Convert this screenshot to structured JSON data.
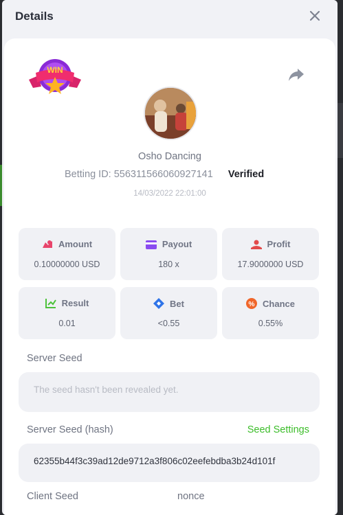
{
  "header": {
    "title": "Details"
  },
  "game": {
    "name": "Osho Dancing",
    "betting_id_label": "Betting ID: 556311566060927141",
    "verified": "Verified",
    "timestamp": "14/03/2022 22:01:00",
    "badge_text": "WIN"
  },
  "stats": [
    {
      "label": "Amount",
      "value": "0.10000000 USD",
      "icon": "amount-icon",
      "color": "#e8446b"
    },
    {
      "label": "Payout",
      "value": "180 x",
      "icon": "payout-icon",
      "color": "#8a4bf0"
    },
    {
      "label": "Profit",
      "value": "17.9000000 USD",
      "icon": "profit-icon",
      "color": "#e24a4a"
    },
    {
      "label": "Result",
      "value": "0.01",
      "icon": "result-icon",
      "color": "#4cc23a"
    },
    {
      "label": "Bet",
      "value": "<0.55",
      "icon": "bet-icon",
      "color": "#2f74e8"
    },
    {
      "label": "Chance",
      "value": "0.55%",
      "icon": "chance-icon",
      "color": "#f0662a"
    }
  ],
  "server_seed": {
    "label": "Server Seed",
    "placeholder": "The seed hasn't been revealed yet."
  },
  "server_seed_hash": {
    "label": "Server Seed (hash)",
    "link": "Seed Settings",
    "value": "62355b44f3c39ad12de9712a3f806c02eefebdba3b24d101f"
  },
  "client_seed": {
    "label": "Client Seed"
  },
  "nonce": {
    "label": "nonce"
  }
}
